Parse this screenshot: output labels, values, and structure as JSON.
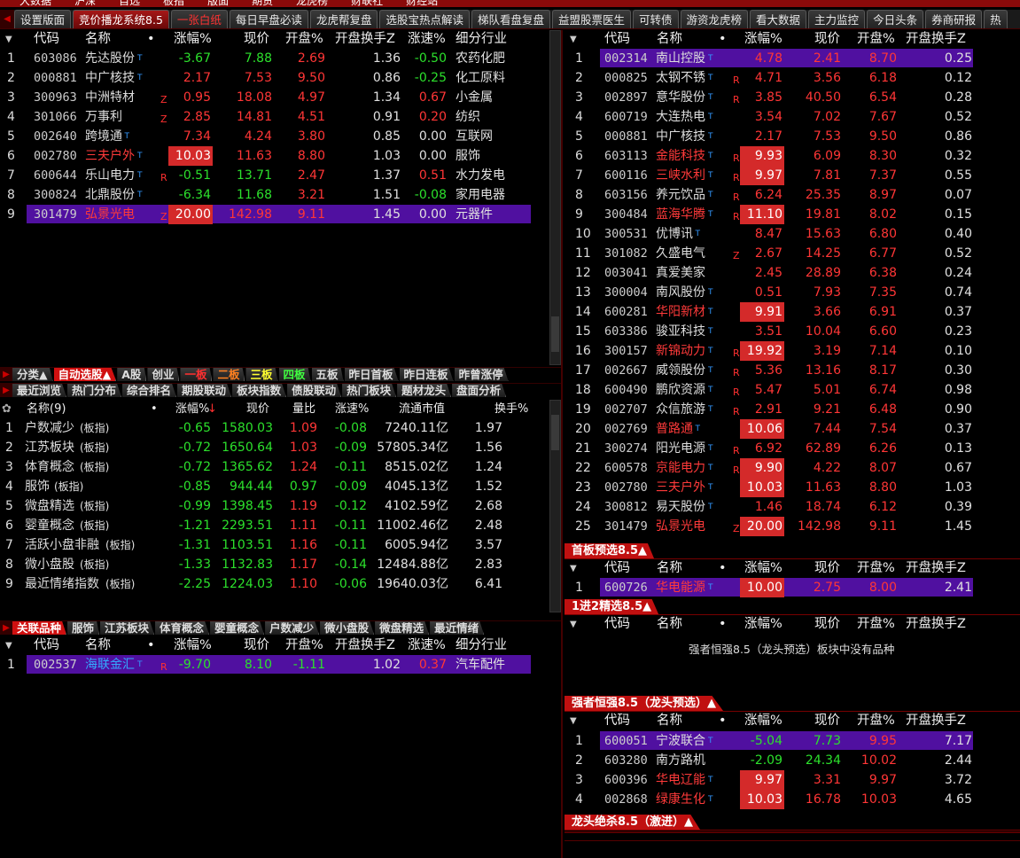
{
  "menu": [
    "大数据",
    "沪深",
    "自选",
    "板指",
    "版面",
    "期货",
    "龙虎榜",
    "财联社",
    "财经站"
  ],
  "tabs": [
    "设置版面",
    "竞价播龙系统8.5",
    "一张白纸",
    "每日早盘必读",
    "龙虎帮复盘",
    "选股宝热点解读",
    "梯队看盘复盘",
    "益盟股票医生",
    "可转债",
    "游资龙虎榜",
    "看大数据",
    "主力监控",
    "今日头条",
    "券商研报",
    "热"
  ],
  "active_tab": 1,
  "left_top": {
    "headers": [
      "代码",
      "名称",
      "•",
      "涨幅%",
      "现价",
      "开盘%",
      "开盘换手Z",
      "涨速%",
      "细分行业"
    ],
    "rows": [
      {
        "idx": "1",
        "code": "603086",
        "name": "先达股份",
        "t": "T",
        "flag": "",
        "chg": "-3.67",
        "price": "7.88",
        "open": "2.69",
        "turn": "1.36",
        "speed": "-0.50",
        "ind": "农药化肥"
      },
      {
        "idx": "2",
        "code": "000881",
        "name": "中广核技",
        "t": "T",
        "flag": "",
        "chg": "2.17",
        "price": "7.53",
        "open": "9.50",
        "turn": "0.86",
        "speed": "-0.25",
        "ind": "化工原料"
      },
      {
        "idx": "3",
        "code": "300963",
        "name": "中洲特材",
        "t": "",
        "flag": "Z",
        "chg": "0.95",
        "price": "18.08",
        "open": "4.97",
        "turn": "1.34",
        "speed": "0.67",
        "ind": "小金属"
      },
      {
        "idx": "4",
        "code": "301066",
        "name": "万事利",
        "t": "",
        "flag": "Z",
        "chg": "2.85",
        "price": "14.81",
        "open": "4.51",
        "turn": "0.91",
        "speed": "0.20",
        "ind": "纺织"
      },
      {
        "idx": "5",
        "code": "002640",
        "name": "跨境通",
        "t": "T",
        "flag": "",
        "chg": "7.34",
        "price": "4.24",
        "open": "3.80",
        "turn": "0.85",
        "speed": "0.00",
        "ind": "互联网"
      },
      {
        "idx": "6",
        "code": "002780",
        "name": "三夫户外",
        "t": "T",
        "flag": "",
        "chg": "10.03",
        "price": "11.63",
        "open": "8.80",
        "turn": "1.03",
        "speed": "0.00",
        "ind": "服饰"
      },
      {
        "idx": "7",
        "code": "600644",
        "name": "乐山电力",
        "t": "T",
        "flag": "R",
        "chg": "-0.51",
        "price": "13.71",
        "open": "2.47",
        "turn": "1.37",
        "speed": "0.51",
        "ind": "水力发电"
      },
      {
        "idx": "8",
        "code": "300824",
        "name": "北鼎股份",
        "t": "T",
        "flag": "",
        "chg": "-6.34",
        "price": "11.68",
        "open": "3.21",
        "turn": "1.51",
        "speed": "-0.08",
        "ind": "家用电器"
      },
      {
        "idx": "9",
        "code": "301479",
        "name": "弘景光电",
        "t": "",
        "flag": "Z",
        "chg": "20.00",
        "price": "142.98",
        "open": "9.11",
        "turn": "1.45",
        "speed": "0.00",
        "ind": "元器件"
      }
    ]
  },
  "strip1": [
    "分类▲",
    "自动选股▲",
    "A股",
    "创业",
    "一板",
    "二板",
    "三板",
    "四板",
    "五板",
    "昨日首板",
    "昨日连板",
    "昨曾涨停"
  ],
  "strip2": [
    "最近浏览",
    "热门分布",
    "综合排名",
    "期股联动",
    "板块指数",
    "债股联动",
    "热门板块",
    "题材龙头",
    "盘面分析"
  ],
  "sector": {
    "headers": [
      "名称(9)",
      "•",
      "涨幅%",
      "现价",
      "量比",
      "涨速%",
      "流通市值",
      "换手%"
    ],
    "rows": [
      {
        "idx": "1",
        "name": "户数减少",
        "tag": "(板指)",
        "chg": "-0.65",
        "price": "1580.03",
        "vr": "1.09",
        "speed": "-0.08",
        "cap": "7240.11亿",
        "turn": "1.97"
      },
      {
        "idx": "2",
        "name": "江苏板块",
        "tag": "(板指)",
        "chg": "-0.72",
        "price": "1650.64",
        "vr": "1.03",
        "speed": "-0.09",
        "cap": "57805.34亿",
        "turn": "1.56"
      },
      {
        "idx": "3",
        "name": "体育概念",
        "tag": "(板指)",
        "chg": "-0.72",
        "price": "1365.62",
        "vr": "1.24",
        "speed": "-0.11",
        "cap": "8515.02亿",
        "turn": "1.24"
      },
      {
        "idx": "4",
        "name": "服饰",
        "tag": "(板指)",
        "chg": "-0.85",
        "price": "944.44",
        "vr": "0.97",
        "speed": "-0.09",
        "cap": "4045.13亿",
        "turn": "1.52"
      },
      {
        "idx": "5",
        "name": "微盘精选",
        "tag": "(板指)",
        "chg": "-0.99",
        "price": "1398.45",
        "vr": "1.19",
        "speed": "-0.12",
        "cap": "4102.59亿",
        "turn": "2.68"
      },
      {
        "idx": "6",
        "name": "婴童概念",
        "tag": "(板指)",
        "chg": "-1.21",
        "price": "2293.51",
        "vr": "1.11",
        "speed": "-0.11",
        "cap": "11002.46亿",
        "turn": "2.48"
      },
      {
        "idx": "7",
        "name": "活跃小盘非融",
        "tag": "(板指)",
        "chg": "-1.31",
        "price": "1103.51",
        "vr": "1.16",
        "speed": "-0.11",
        "cap": "6005.94亿",
        "turn": "3.57"
      },
      {
        "idx": "8",
        "name": "微小盘股",
        "tag": "(板指)",
        "chg": "-1.33",
        "price": "1132.83",
        "vr": "1.17",
        "speed": "-0.14",
        "cap": "12484.88亿",
        "turn": "2.83"
      },
      {
        "idx": "9",
        "name": "最近情绪指数",
        "tag": "(板指)",
        "chg": "-2.25",
        "price": "1224.03",
        "vr": "1.10",
        "speed": "-0.06",
        "cap": "19640.03亿",
        "turn": "6.41"
      }
    ]
  },
  "strip3": [
    "关联品种",
    "服饰",
    "江苏板块",
    "体育概念",
    "婴童概念",
    "户数减少",
    "微小盘股",
    "微盘精选",
    "最近情绪"
  ],
  "related": {
    "headers": [
      "代码",
      "名称",
      "•",
      "涨幅%",
      "现价",
      "开盘%",
      "开盘换手Z",
      "涨速%",
      "细分行业"
    ],
    "rows": [
      {
        "idx": "1",
        "code": "002537",
        "name": "海联金汇",
        "t": "T",
        "flag": "R",
        "chg": "-9.70",
        "price": "8.10",
        "open": "-1.11",
        "turn": "1.02",
        "speed": "0.37",
        "ind": "汽车配件"
      }
    ]
  },
  "right_top": {
    "headers": [
      "代码",
      "名称",
      "•",
      "涨幅%",
      "现价",
      "开盘%",
      "开盘换手Z"
    ],
    "rows": [
      {
        "idx": "1",
        "code": "002314",
        "name": "南山控股",
        "t": "T",
        "flag": "",
        "chg": "4.78",
        "price": "2.41",
        "open": "8.70",
        "turn": "0.25"
      },
      {
        "idx": "2",
        "code": "000825",
        "name": "太钢不锈",
        "t": "T",
        "flag": "R",
        "chg": "4.71",
        "price": "3.56",
        "open": "6.18",
        "turn": "0.12"
      },
      {
        "idx": "3",
        "code": "002897",
        "name": "意华股份",
        "t": "T",
        "flag": "R",
        "chg": "3.85",
        "price": "40.50",
        "open": "6.54",
        "turn": "0.28"
      },
      {
        "idx": "4",
        "code": "600719",
        "name": "大连热电",
        "t": "T",
        "flag": "",
        "chg": "3.54",
        "price": "7.02",
        "open": "7.67",
        "turn": "0.52"
      },
      {
        "idx": "5",
        "code": "000881",
        "name": "中广核技",
        "t": "T",
        "flag": "",
        "chg": "2.17",
        "price": "7.53",
        "open": "9.50",
        "turn": "0.86"
      },
      {
        "idx": "6",
        "code": "603113",
        "name": "金能科技",
        "t": "T",
        "flag": "R",
        "chg": "9.93",
        "price": "6.09",
        "open": "8.30",
        "turn": "0.32"
      },
      {
        "idx": "7",
        "code": "600116",
        "name": "三峡水利",
        "t": "T",
        "flag": "R",
        "chg": "9.97",
        "price": "7.81",
        "open": "7.37",
        "turn": "0.55"
      },
      {
        "idx": "8",
        "code": "603156",
        "name": "养元饮品",
        "t": "T",
        "flag": "R",
        "chg": "6.24",
        "price": "25.35",
        "open": "8.97",
        "turn": "0.07"
      },
      {
        "idx": "9",
        "code": "300484",
        "name": "蓝海华腾",
        "t": "T",
        "flag": "R",
        "chg": "11.10",
        "price": "19.81",
        "open": "8.02",
        "turn": "0.15"
      },
      {
        "idx": "10",
        "code": "300531",
        "name": "优博讯",
        "t": "T",
        "flag": "",
        "chg": "8.47",
        "price": "15.63",
        "open": "6.80",
        "turn": "0.40"
      },
      {
        "idx": "11",
        "code": "301082",
        "name": "久盛电气",
        "t": "",
        "flag": "Z",
        "chg": "2.67",
        "price": "14.25",
        "open": "6.77",
        "turn": "0.52"
      },
      {
        "idx": "12",
        "code": "003041",
        "name": "真爱美家",
        "t": "",
        "flag": "",
        "chg": "2.45",
        "price": "28.89",
        "open": "6.38",
        "turn": "0.24"
      },
      {
        "idx": "13",
        "code": "300004",
        "name": "南风股份",
        "t": "T",
        "flag": "",
        "chg": "0.51",
        "price": "7.93",
        "open": "7.35",
        "turn": "0.74"
      },
      {
        "idx": "14",
        "code": "600281",
        "name": "华阳新材",
        "t": "T",
        "flag": "",
        "chg": "9.91",
        "price": "3.66",
        "open": "6.91",
        "turn": "0.37"
      },
      {
        "idx": "15",
        "code": "603386",
        "name": "骏亚科技",
        "t": "T",
        "flag": "",
        "chg": "3.51",
        "price": "10.04",
        "open": "6.60",
        "turn": "0.23"
      },
      {
        "idx": "16",
        "code": "300157",
        "name": "新锦动力",
        "t": "T",
        "flag": "R",
        "chg": "19.92",
        "price": "3.19",
        "open": "7.14",
        "turn": "0.10"
      },
      {
        "idx": "17",
        "code": "002667",
        "name": "威领股份",
        "t": "T",
        "flag": "R",
        "chg": "5.36",
        "price": "13.16",
        "open": "8.17",
        "turn": "0.30"
      },
      {
        "idx": "18",
        "code": "600490",
        "name": "鹏欣资源",
        "t": "T",
        "flag": "R",
        "chg": "5.47",
        "price": "5.01",
        "open": "6.74",
        "turn": "0.98"
      },
      {
        "idx": "19",
        "code": "002707",
        "name": "众信旅游",
        "t": "T",
        "flag": "R",
        "chg": "2.91",
        "price": "9.21",
        "open": "6.48",
        "turn": "0.90"
      },
      {
        "idx": "20",
        "code": "002769",
        "name": "普路通",
        "t": "T",
        "flag": "",
        "chg": "10.06",
        "price": "7.44",
        "open": "7.54",
        "turn": "0.37"
      },
      {
        "idx": "21",
        "code": "300274",
        "name": "阳光电源",
        "t": "T",
        "flag": "R",
        "chg": "6.92",
        "price": "62.89",
        "open": "6.26",
        "turn": "0.13"
      },
      {
        "idx": "22",
        "code": "600578",
        "name": "京能电力",
        "t": "T",
        "flag": "R",
        "chg": "9.90",
        "price": "4.22",
        "open": "8.07",
        "turn": "0.67"
      },
      {
        "idx": "23",
        "code": "002780",
        "name": "三夫户外",
        "t": "T",
        "flag": "",
        "chg": "10.03",
        "price": "11.63",
        "open": "8.80",
        "turn": "1.03"
      },
      {
        "idx": "24",
        "code": "300812",
        "name": "易天股份",
        "t": "T",
        "flag": "",
        "chg": "1.46",
        "price": "18.74",
        "open": "6.12",
        "turn": "0.39"
      },
      {
        "idx": "25",
        "code": "301479",
        "name": "弘景光电",
        "t": "",
        "flag": "Z",
        "chg": "20.00",
        "price": "142.98",
        "open": "9.11",
        "turn": "1.45"
      }
    ]
  },
  "first_board": {
    "title": "首板预选8.5▲",
    "headers": [
      "代码",
      "名称",
      "•",
      "涨幅%",
      "现价",
      "开盘%",
      "开盘换手Z"
    ],
    "rows": [
      {
        "idx": "1",
        "code": "600726",
        "name": "华电能源",
        "t": "T",
        "flag": "",
        "chg": "10.00",
        "price": "2.75",
        "open": "8.00",
        "turn": "2.41"
      }
    ]
  },
  "one_to_two": {
    "title": "1进2精选8.5▲",
    "headers": [
      "代码",
      "名称",
      "•",
      "涨幅%",
      "现价",
      "开盘%",
      "开盘换手Z"
    ],
    "empty": "强者恒强8.5（龙头预选）板块中没有品种"
  },
  "strong": {
    "title": "强者恒强8.5（龙头预选）▲",
    "headers": [
      "代码",
      "名称",
      "•",
      "涨幅%",
      "现价",
      "开盘%",
      "开盘换手Z"
    ],
    "rows": [
      {
        "idx": "1",
        "code": "600051",
        "name": "宁波联合",
        "t": "T",
        "flag": "",
        "chg": "-5.04",
        "price": "7.73",
        "open": "9.95",
        "turn": "7.17"
      },
      {
        "idx": "2",
        "code": "603280",
        "name": "南方路机",
        "t": "",
        "flag": "",
        "chg": "-2.09",
        "price": "24.34",
        "open": "10.02",
        "turn": "2.44"
      },
      {
        "idx": "3",
        "code": "600396",
        "name": "华电辽能",
        "t": "T",
        "flag": "",
        "chg": "9.97",
        "price": "3.31",
        "open": "9.97",
        "turn": "3.72"
      },
      {
        "idx": "4",
        "code": "002868",
        "name": "绿康生化",
        "t": "T",
        "flag": "",
        "chg": "10.03",
        "price": "16.78",
        "open": "10.03",
        "turn": "4.65"
      }
    ]
  },
  "kill": {
    "title": "龙头绝杀8.5（激进）▲"
  },
  "colors": {
    "up": "#ff3636",
    "down": "#2ce02c",
    "highlight": "#5010a0",
    "limit": "#d42a2a",
    "accent": "#c01010"
  }
}
